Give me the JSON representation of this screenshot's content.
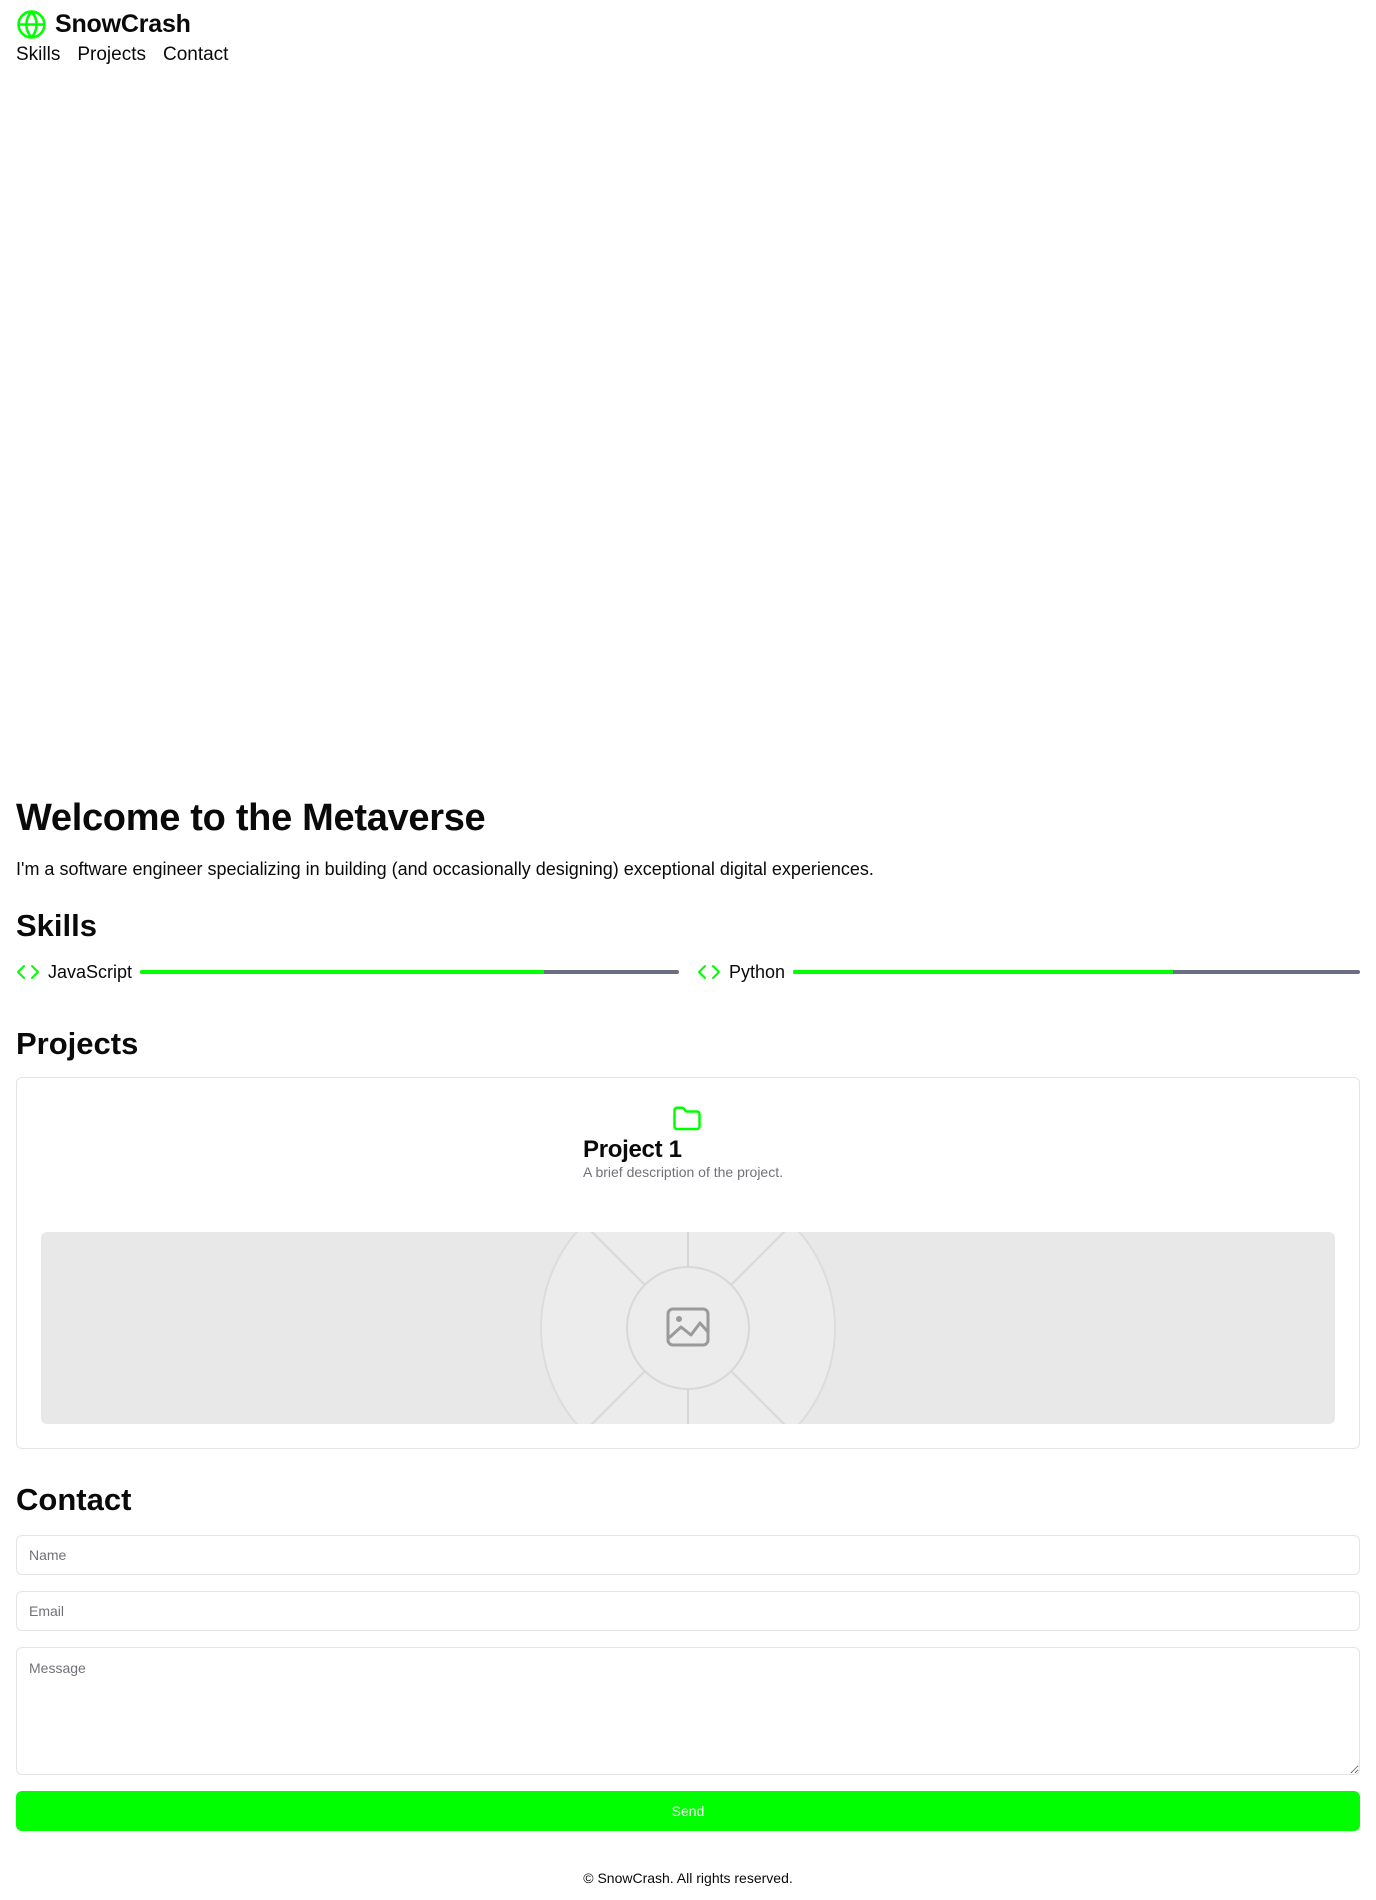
{
  "brand": {
    "name": "SnowCrash",
    "icon": "globe-icon",
    "accent_color": "#00ff00"
  },
  "nav": {
    "items": [
      "Skills",
      "Projects",
      "Contact"
    ]
  },
  "hero": {
    "title": "Welcome to the Metaverse",
    "text": "I'm a software engineer specializing in building (and occasionally designing) exceptional digital experiences."
  },
  "skills": {
    "title": "Skills",
    "items": [
      {
        "label": "JavaScript",
        "icon": "code-icon",
        "level": 0.75
      },
      {
        "label": "Python",
        "icon": "code-icon",
        "level": 0.67
      }
    ]
  },
  "projects": {
    "title": "Projects",
    "items": [
      {
        "name": "Project 1",
        "description": "A brief description of the project.",
        "icon": "folder-icon",
        "image": "image-placeholder-icon"
      }
    ]
  },
  "contact": {
    "title": "Contact",
    "name_placeholder": "Name",
    "email_placeholder": "Email",
    "message_placeholder": "Message",
    "send_label": "Send",
    "send_color": "#00ff00"
  },
  "footer": {
    "text": "© SnowCrash. All rights reserved."
  }
}
